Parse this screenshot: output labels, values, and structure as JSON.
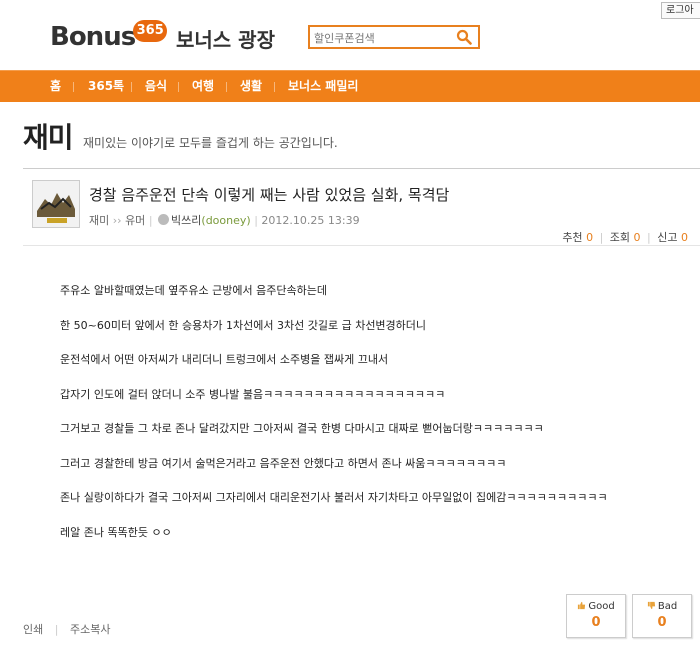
{
  "header": {
    "login_label": "로그아",
    "logo_text": "Bonus",
    "logo_badge": "365",
    "site_title": "보너스 광장",
    "search_placeholder": "할인쿠폰검색"
  },
  "nav": {
    "items": [
      "홈",
      "365톡",
      "음식",
      "여행",
      "생활",
      "보너스 패밀리"
    ]
  },
  "section": {
    "title": "재미",
    "description": "재미있는 이야기로 모두를 즐겁게 하는 공간입니다."
  },
  "post": {
    "title": "경찰 음주운전 단속 이렇게 째는 사람 있었음 실화, 목격담",
    "category": "재미",
    "subcategory": "유머",
    "author_name": "빅쓰리",
    "author_id": "(dooney)",
    "date": "2012.10.25 13:39",
    "stats": {
      "recommend_label": "추천",
      "recommend_count": "0",
      "views_label": "조회",
      "views_count": "0",
      "report_label": "신고",
      "report_count": "0"
    },
    "body": [
      "주유소 알바할때였는데 옆주유소 근방에서 음주단속하는데",
      "한 50~60미터 앞에서 한 승용차가 1차선에서 3차선 갓길로 급 차선변경하더니",
      "운전석에서 어떤 아저씨가 내리더니 트렁크에서 소주병을 잽싸게 끄내서",
      "갑자기 인도에 걸터 앉더니 소주 병나발 불음ㅋㅋㅋㅋㅋㅋㅋㅋㅋㅋㅋㅋㅋㅋㅋㅋㅋㅋ",
      "그거보고 경찰들 그 차로 존나 달려갔지만 그아저씨 결국 한병 다마시고 대짜로 뻗어눕더랑ㅋㅋㅋㅋㅋㅋㅋ",
      "그러고 경찰한테 방금 여기서 술먹은거라고 음주운전 안했다고 하면서 존나 싸움ㅋㅋㅋㅋㅋㅋㅋㅋ",
      "존나 실랑이하다가 결국 그아저씨 그자리에서 대리운전기사 불러서 자기차타고 아무일없이 집에감ㅋㅋㅋㅋㅋㅋㅋㅋㅋㅋ",
      "레알 존나 똑똑한듯 ㅇㅇ"
    ]
  },
  "footer": {
    "print_label": "인쇄",
    "copy_url_label": "주소복사",
    "good_label": "Good",
    "good_count": "0",
    "bad_label": "Bad",
    "bad_count": "0"
  },
  "colors": {
    "accent": "#f08019",
    "count": "#e8801f"
  }
}
